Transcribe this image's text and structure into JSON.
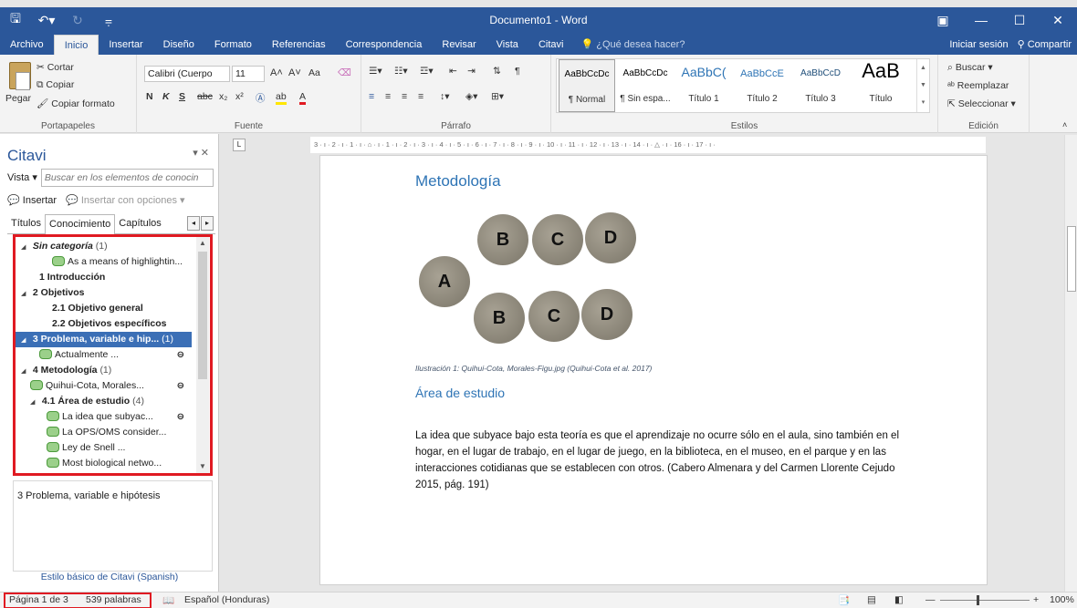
{
  "window": {
    "title": "Documento1 - Word",
    "quick_access": [
      "save-icon",
      "undo-icon",
      "redo-icon",
      "customize-icon"
    ],
    "controls": [
      "ribbon-display-icon",
      "minimize-icon",
      "maximize-icon",
      "close-icon"
    ]
  },
  "menu": {
    "tabs": [
      "Archivo",
      "Inicio",
      "Insertar",
      "Diseño",
      "Formato",
      "Referencias",
      "Correspondencia",
      "Revisar",
      "Vista",
      "Citavi"
    ],
    "active_tab": "Inicio",
    "tell_me": "¿Qué desea hacer?",
    "signin": "Iniciar sesión",
    "share": "Compartir"
  },
  "ribbon": {
    "clipboard": {
      "label": "Portapapeles",
      "paste": "Pegar",
      "cut": "Cortar",
      "copy": "Copiar",
      "format_painter": "Copiar formato"
    },
    "font": {
      "label": "Fuente",
      "font_name": "Calibri (Cuerpo",
      "font_size": "11",
      "case": "Aa"
    },
    "paragraph": {
      "label": "Párrafo"
    },
    "styles": {
      "label": "Estilos",
      "items": [
        {
          "sample": "AaBbCcDc",
          "name": "¶ Normal"
        },
        {
          "sample": "AaBbCcDc",
          "name": "¶ Sin espa..."
        },
        {
          "sample": "AaBbC(",
          "name": "Título 1"
        },
        {
          "sample": "AaBbCcE",
          "name": "Título 2"
        },
        {
          "sample": "AaBbCcD",
          "name": "Título 3"
        },
        {
          "sample": "AaB",
          "name": "Título"
        }
      ]
    },
    "editing": {
      "label": "Edición",
      "find": "Buscar",
      "replace": "Reemplazar",
      "select": "Seleccionar"
    }
  },
  "citavi_pane": {
    "title": "Citavi",
    "view_button": "Vista",
    "search_placeholder": "Buscar en los elementos de conocin",
    "insert": "Insertar",
    "insert_options": "Insertar con opciones",
    "tabs": [
      "Títulos",
      "Conocimiento",
      "Capítulos"
    ],
    "active_tab": "Conocimiento",
    "tree": [
      {
        "level": 0,
        "arrow": true,
        "label": "Sin categoría",
        "count": "(1)",
        "style": "bold-italic"
      },
      {
        "level": 2,
        "icon": "quote-icon",
        "label": "As a means of highlightin..."
      },
      {
        "level": 1,
        "label": "1 Introducción",
        "style": "bold"
      },
      {
        "level": 0,
        "arrow": true,
        "label": "2 Objetivos",
        "style": "bold"
      },
      {
        "level": 2,
        "label": "2.1 Objetivo general",
        "style": "bold"
      },
      {
        "level": 2,
        "label": "2.2 Objetivos específicos",
        "style": "bold"
      },
      {
        "level": 0,
        "arrow": true,
        "label": "3 Problema, variable e hip...",
        "count": "(1)",
        "style": "bold",
        "selected": true
      },
      {
        "level": 2,
        "icon": "quote-icon",
        "label": "Actualmente ...",
        "link": true
      },
      {
        "level": 0,
        "arrow": true,
        "label": "4 Metodología",
        "count": "(1)",
        "style": "bold"
      },
      {
        "level": 1,
        "icon": "quote-icon",
        "label": "Quihui-Cota, Morales...",
        "link": true
      },
      {
        "level": 1,
        "arrow": true,
        "label": "4.1 Área de estudio",
        "count": "(4)",
        "style": "bold"
      },
      {
        "level": 2,
        "icon": "quote-icon",
        "label": "La idea que subyac...",
        "link": true
      },
      {
        "level": 2,
        "icon": "quote-icon",
        "label": "La OPS/OMS consider..."
      },
      {
        "level": 2,
        "icon": "quote-icon",
        "label": "Ley de Snell ..."
      },
      {
        "level": 2,
        "icon": "quote-icon",
        "label": "Most biological netwo..."
      }
    ],
    "preview": "3 Problema, variable e hipótesis",
    "style_link": "Estilo básico de Citavi (Spanish)"
  },
  "ruler": {
    "text": "3 · ı · 2 · ı · 1 · ı · ⌂ · ı · 1 · ı · 2 · ı · 3 · ı · 4 · ı · 5 · ı · 6 · ı · 7 · ı · 8 · ı · 9 · ı · 10 · ı · 11 · ı · 12 · ı · 13 · ı · 14 · ı · △ · ı · 16 · ı · 17 · ı ·"
  },
  "document": {
    "heading1": "Metodología",
    "figure_discs_top": [
      "B",
      "C",
      "D"
    ],
    "figure_disc_left": "A",
    "figure_discs_bottom": [
      "B",
      "C",
      "D"
    ],
    "caption": "Ilustración 1: Quihui-Cota, Morales-Figu.jpg (Quihui-Cota et al. 2017)",
    "heading2": "Área de estudio",
    "body": "La idea que subyace bajo esta teoría es que el aprendizaje no ocurre sólo en el aula, sino también en el hogar, en el lugar de trabajo, en el lugar de juego, en la biblioteca, en el museo, en el parque y en las interacciones cotidianas que se establecen con otros. (Cabero Almenara y del Carmen Llorente Cejudo 2015, pág. 191)"
  },
  "status": {
    "page": "Página 1 de 3",
    "words": "539 palabras",
    "language": "Español (Honduras)",
    "zoom": "100%"
  }
}
